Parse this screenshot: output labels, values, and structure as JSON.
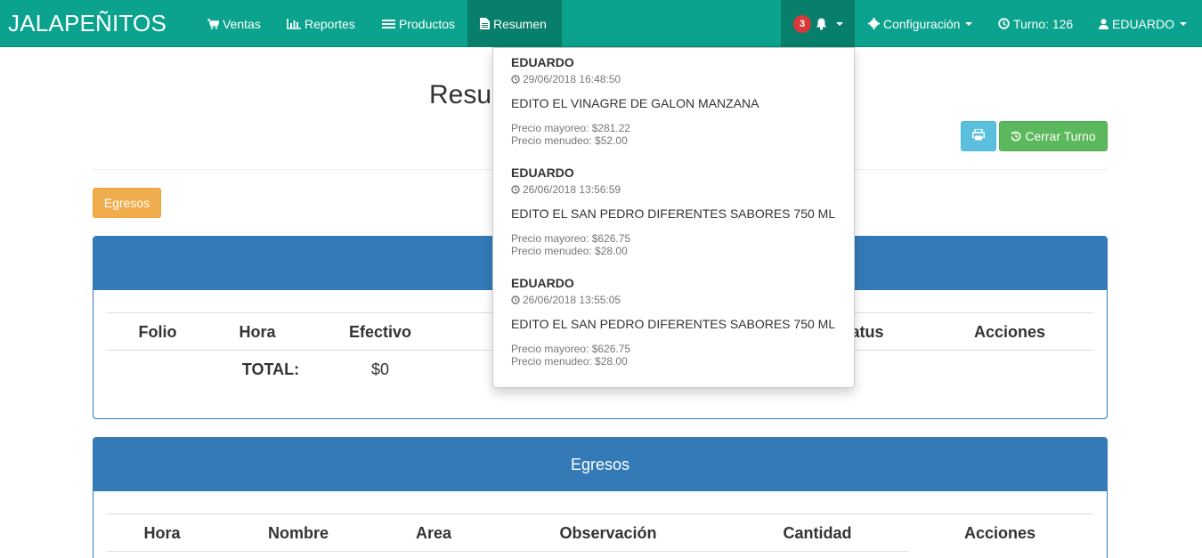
{
  "navbar": {
    "brand": "JALAPEÑITOS",
    "items": [
      {
        "label": "Ventas",
        "icon": "cart-icon"
      },
      {
        "label": "Reportes",
        "icon": "bar-chart-icon"
      },
      {
        "label": "Productos",
        "icon": "list-icon"
      },
      {
        "label": "Resumen",
        "icon": "file-icon"
      }
    ],
    "notification_count": "3",
    "config_label": "Configuración",
    "turno_label": "Turno: 126",
    "user_label": "EDUARDO"
  },
  "page": {
    "title": "Resumen",
    "close_shift_label": "Cerrar Turno",
    "egresos_button": "Egresos"
  },
  "panel1": {
    "title": "",
    "headers": [
      "Folio",
      "Hora",
      "Efectivo",
      "",
      "",
      "Status",
      "Acciones"
    ],
    "total_label": "TOTAL:",
    "total_value": "$0"
  },
  "panel2": {
    "title": "Egresos",
    "headers": [
      "Hora",
      "Nombre",
      "Area",
      "Observación",
      "Cantidad",
      "Acciones"
    ]
  },
  "notifications": [
    {
      "user": "EDUARDO",
      "time": "29/06/2018 16:48:50",
      "action": "EDITO EL VINAGRE DE GALON MANZANA",
      "price_mayoreo": "Precio mayoreo: $281.22",
      "price_menudeo": "Precio menudeo: $52.00"
    },
    {
      "user": "EDUARDO",
      "time": "26/06/2018 13:56:59",
      "action": "EDITO EL SAN PEDRO DIFERENTES SABORES 750 ML",
      "price_mayoreo": "Precio mayoreo: $626.75",
      "price_menudeo": "Precio menudeo: $28.00"
    },
    {
      "user": "EDUARDO",
      "time": "26/06/2018 13:55:05",
      "action": "EDITO EL SAN PEDRO DIFERENTES SABORES 750 ML",
      "price_mayoreo": "Precio mayoreo: $626.75",
      "price_menudeo": "Precio menudeo: $28.00"
    }
  ],
  "colors": {
    "navbar": "#0ba38e",
    "navbar_active": "#077f6b",
    "panel_primary": "#337ab7",
    "btn_info": "#5bc0de",
    "btn_success": "#5cb85c",
    "btn_warning": "#f0ad4e",
    "badge": "#d9383a"
  }
}
